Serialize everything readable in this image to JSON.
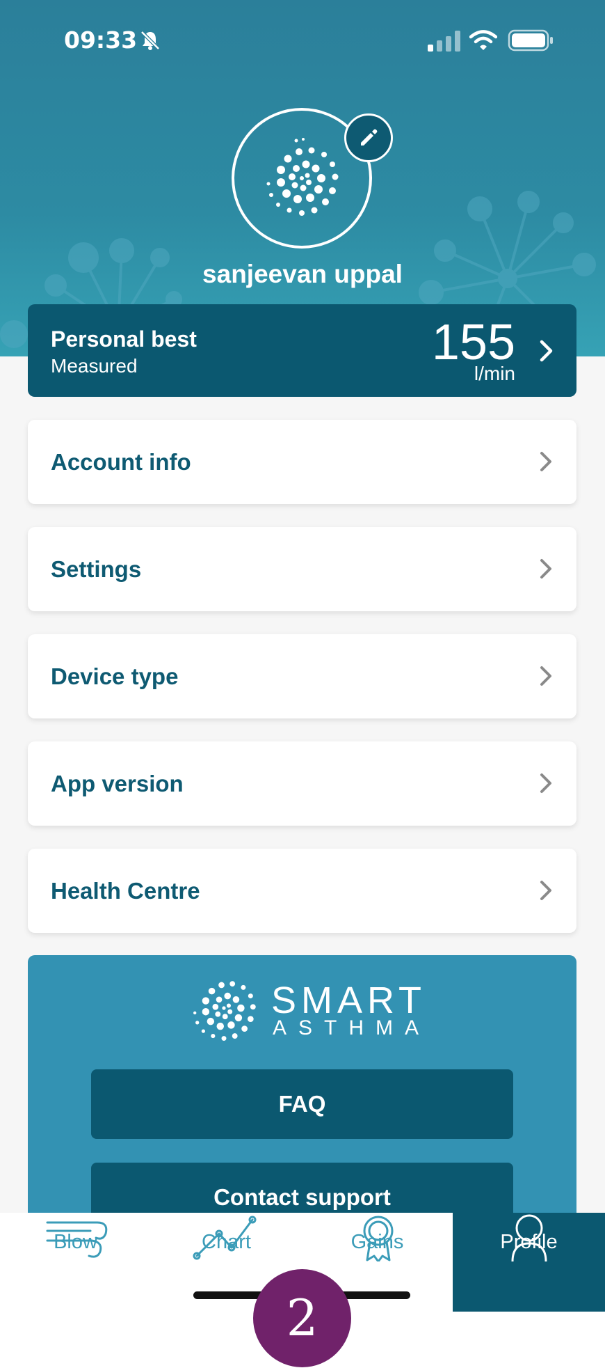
{
  "status_bar": {
    "time": "09:33",
    "icons": [
      "bell-muted-icon",
      "signal-icon",
      "wifi-icon",
      "battery-icon"
    ]
  },
  "profile": {
    "name": "sanjeevan uppal",
    "edit_icon": "pencil-icon"
  },
  "personal_best": {
    "title": "Personal best",
    "subtitle": "Measured",
    "value": "155",
    "unit": "l/min"
  },
  "menu": [
    {
      "label": "Account info"
    },
    {
      "label": "Settings"
    },
    {
      "label": "Device type"
    },
    {
      "label": "App version"
    },
    {
      "label": "Health Centre"
    }
  ],
  "brand": {
    "name": "SMART",
    "sub": "ASTHMA"
  },
  "buttons": {
    "faq": "FAQ",
    "contact": "Contact support"
  },
  "tabs": [
    {
      "label": "Blow",
      "icon": "wind-icon"
    },
    {
      "label": "Chart",
      "icon": "line-chart-icon"
    },
    {
      "label": "Gains",
      "icon": "medal-icon"
    },
    {
      "label": "Profile",
      "icon": "person-icon",
      "active": true
    }
  ],
  "step_badge": "2",
  "colors": {
    "primary": "#0b5870",
    "accent": "#3392b3",
    "header": "#2d8ba3",
    "badge": "#70226a"
  }
}
